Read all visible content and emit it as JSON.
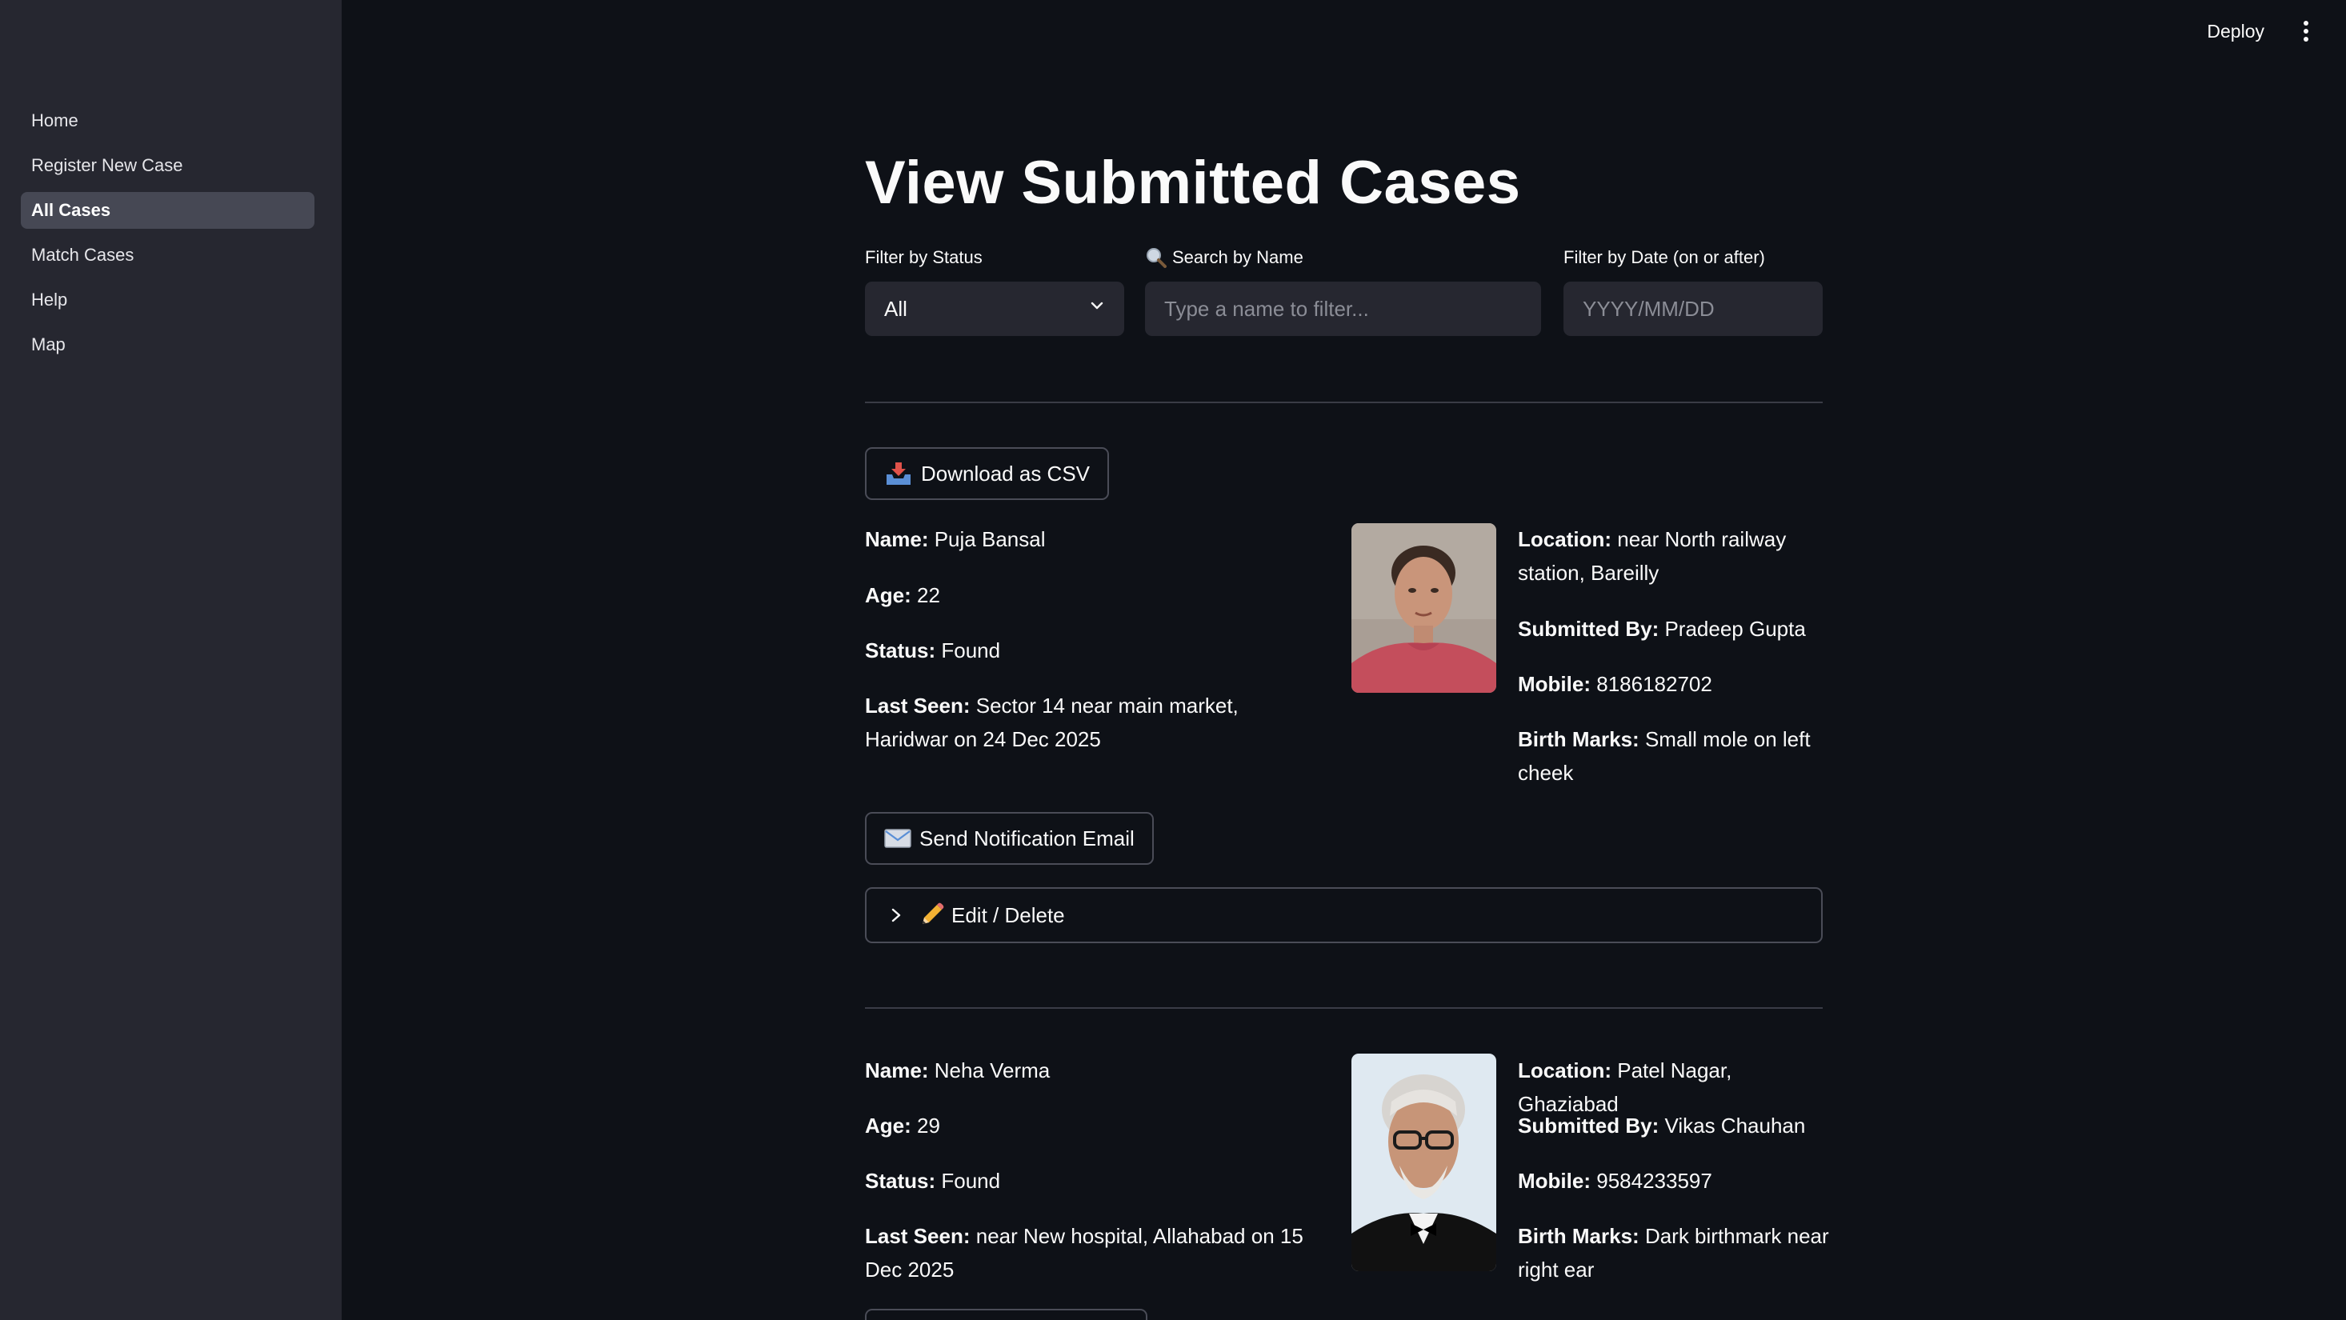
{
  "topbar": {
    "deploy_label": "Deploy"
  },
  "sidebar": {
    "items": [
      {
        "label": "Home"
      },
      {
        "label": "Register New Case"
      },
      {
        "label": "All Cases",
        "active": true
      },
      {
        "label": "Match Cases"
      },
      {
        "label": "Help"
      },
      {
        "label": "Map"
      }
    ]
  },
  "page": {
    "title": "View Submitted Cases"
  },
  "filters": {
    "status": {
      "label": "Filter by Status",
      "value": "All"
    },
    "name": {
      "icon": "magnifier-icon",
      "label": "Search by Name",
      "placeholder": "Type a name to filter..."
    },
    "date": {
      "label": "Filter by Date (on or after)",
      "placeholder": "YYYY/MM/DD"
    }
  },
  "actions": {
    "download_label": "Download as CSV"
  },
  "cases": [
    {
      "name_label": "Name:",
      "name": "Puja Bansal",
      "age_label": "Age:",
      "age": "22",
      "status_label": "Status:",
      "status": "Found",
      "last_seen_label": "Last Seen:",
      "last_seen": "Sector 14 near main market, Haridwar on 24 Dec 2025",
      "location_label": "Location:",
      "location": "near North railway station, Bareilly",
      "submitted_by_label": "Submitted By:",
      "submitted_by": "Pradeep Gupta",
      "mobile_label": "Mobile:",
      "mobile": "8186182702",
      "birth_marks_label": "Birth Marks:",
      "birth_marks": "Small mole on left cheek",
      "notify_label": "Send Notification Email",
      "edit_label": "Edit / Delete"
    },
    {
      "name_label": "Name:",
      "name": "Neha Verma",
      "age_label": "Age:",
      "age": "29",
      "status_label": "Status:",
      "status": "Found",
      "last_seen_label": "Last Seen:",
      "last_seen": "near New hospital, Allahabad on 15 Dec 2025",
      "location_label": "Location:",
      "location": "Patel Nagar, Ghaziabad",
      "submitted_by_label": "Submitted By:",
      "submitted_by": "Vikas Chauhan",
      "mobile_label": "Mobile:",
      "mobile": "9584233597",
      "birth_marks_label": "Birth Marks:",
      "birth_marks": "Dark birthmark near right ear"
    }
  ],
  "colors": {
    "background": "#0e1117",
    "sidebar": "#262730",
    "field": "#262730",
    "border": "#4a4c57"
  },
  "icons": {
    "download": "inbox-tray-icon",
    "notify": "envelope-icon",
    "edit": "pencil-icon",
    "expand": "chevron-right-icon"
  }
}
